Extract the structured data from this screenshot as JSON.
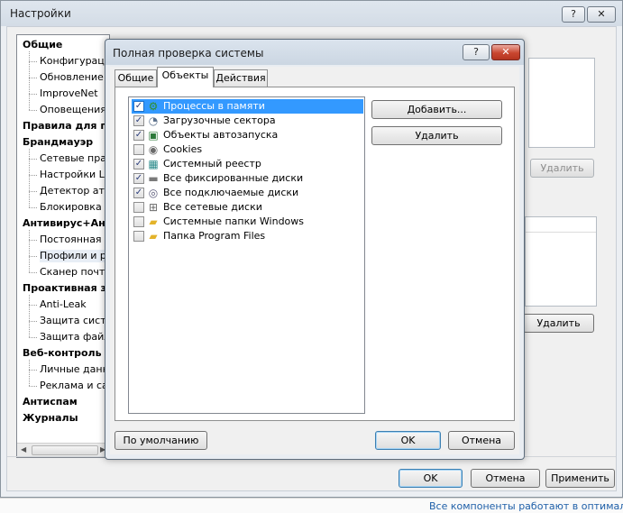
{
  "outer": {
    "title": "Настройки",
    "help_label": "?",
    "close_label": "✕",
    "tree": [
      {
        "label": "Общие",
        "group": true
      },
      {
        "label": "Конфигураци",
        "group": false
      },
      {
        "label": "Обновление",
        "group": false
      },
      {
        "label": "ImproveNet",
        "group": false
      },
      {
        "label": "Оповещения",
        "group": false
      },
      {
        "label": "Правила для пр",
        "group": true
      },
      {
        "label": "Брандмауэр",
        "group": true
      },
      {
        "label": "Сетевые прав",
        "group": false
      },
      {
        "label": "Настройки LA",
        "group": false
      },
      {
        "label": "Детектор атак",
        "group": false
      },
      {
        "label": "Блокировка I",
        "group": false
      },
      {
        "label": "Антивирус+Анти",
        "group": true
      },
      {
        "label": "Постоянная з",
        "group": false
      },
      {
        "label": "Профили и р",
        "group": false,
        "selected": true
      },
      {
        "label": "Сканер почты",
        "group": false
      },
      {
        "label": "Проактивная за",
        "group": true
      },
      {
        "label": "Anti-Leak",
        "group": false
      },
      {
        "label": "Защита систе",
        "group": false
      },
      {
        "label": "Защита файл",
        "group": false
      },
      {
        "label": "Веб-контроль",
        "group": true
      },
      {
        "label": "Личные данн",
        "group": false
      },
      {
        "label": "Реклама и са",
        "group": false
      },
      {
        "label": "Антиспам",
        "group": true
      },
      {
        "label": "Журналы",
        "group": true
      }
    ],
    "remove_label_1": "Удалить",
    "remove_label_2": "Удалить",
    "ok_label": "OK",
    "cancel_label": "Отмена",
    "apply_label": "Применить",
    "status_text": "Все компоненты работают в оптималь"
  },
  "dialog": {
    "title": "Полная проверка системы",
    "help_label": "?",
    "close_label": "✕",
    "tabs": [
      {
        "label": "Общие"
      },
      {
        "label": "Объекты",
        "active": true
      },
      {
        "label": "Действия"
      }
    ],
    "items": [
      {
        "label": "Процессы в памяти",
        "checked": true,
        "selected": true,
        "icon": "gear-process-icon",
        "glyph": "⚙",
        "color": "#2f8f2f"
      },
      {
        "label": "Загрузочные сектора",
        "checked": true,
        "icon": "boot-sector-icon",
        "glyph": "◔",
        "color": "#5a6f8a"
      },
      {
        "label": "Объекты автозапуска",
        "checked": true,
        "icon": "autorun-icon",
        "glyph": "▣",
        "color": "#2c7a3a"
      },
      {
        "label": "Cookies",
        "checked": false,
        "icon": "cookies-icon",
        "glyph": "◉",
        "color": "#6b6b6b"
      },
      {
        "label": "Системный реестр",
        "checked": true,
        "icon": "registry-icon",
        "glyph": "▦",
        "color": "#2a8a8a"
      },
      {
        "label": "Все фиксированные диски",
        "checked": true,
        "icon": "fixed-disk-icon",
        "glyph": "▬",
        "color": "#7a7a7a"
      },
      {
        "label": "Все подключаемые диски",
        "checked": true,
        "icon": "removable-disk-icon",
        "glyph": "◎",
        "color": "#5b5b7a"
      },
      {
        "label": "Все сетевые диски",
        "checked": false,
        "icon": "network-disk-icon",
        "glyph": "⊞",
        "color": "#6a6a6a"
      },
      {
        "label": "Системные папки Windows",
        "checked": false,
        "icon": "folder-icon",
        "glyph": "▰",
        "color": "#e3b32a"
      },
      {
        "label": "Папка Program Files",
        "checked": false,
        "icon": "folder-add-icon",
        "glyph": "▰",
        "color": "#e3b32a"
      }
    ],
    "add_label": "Добавить...",
    "remove_label": "Удалить",
    "default_label": "По умолчанию",
    "ok_label": "OK",
    "cancel_label": "Отмена",
    "check_glyph": "✓"
  }
}
